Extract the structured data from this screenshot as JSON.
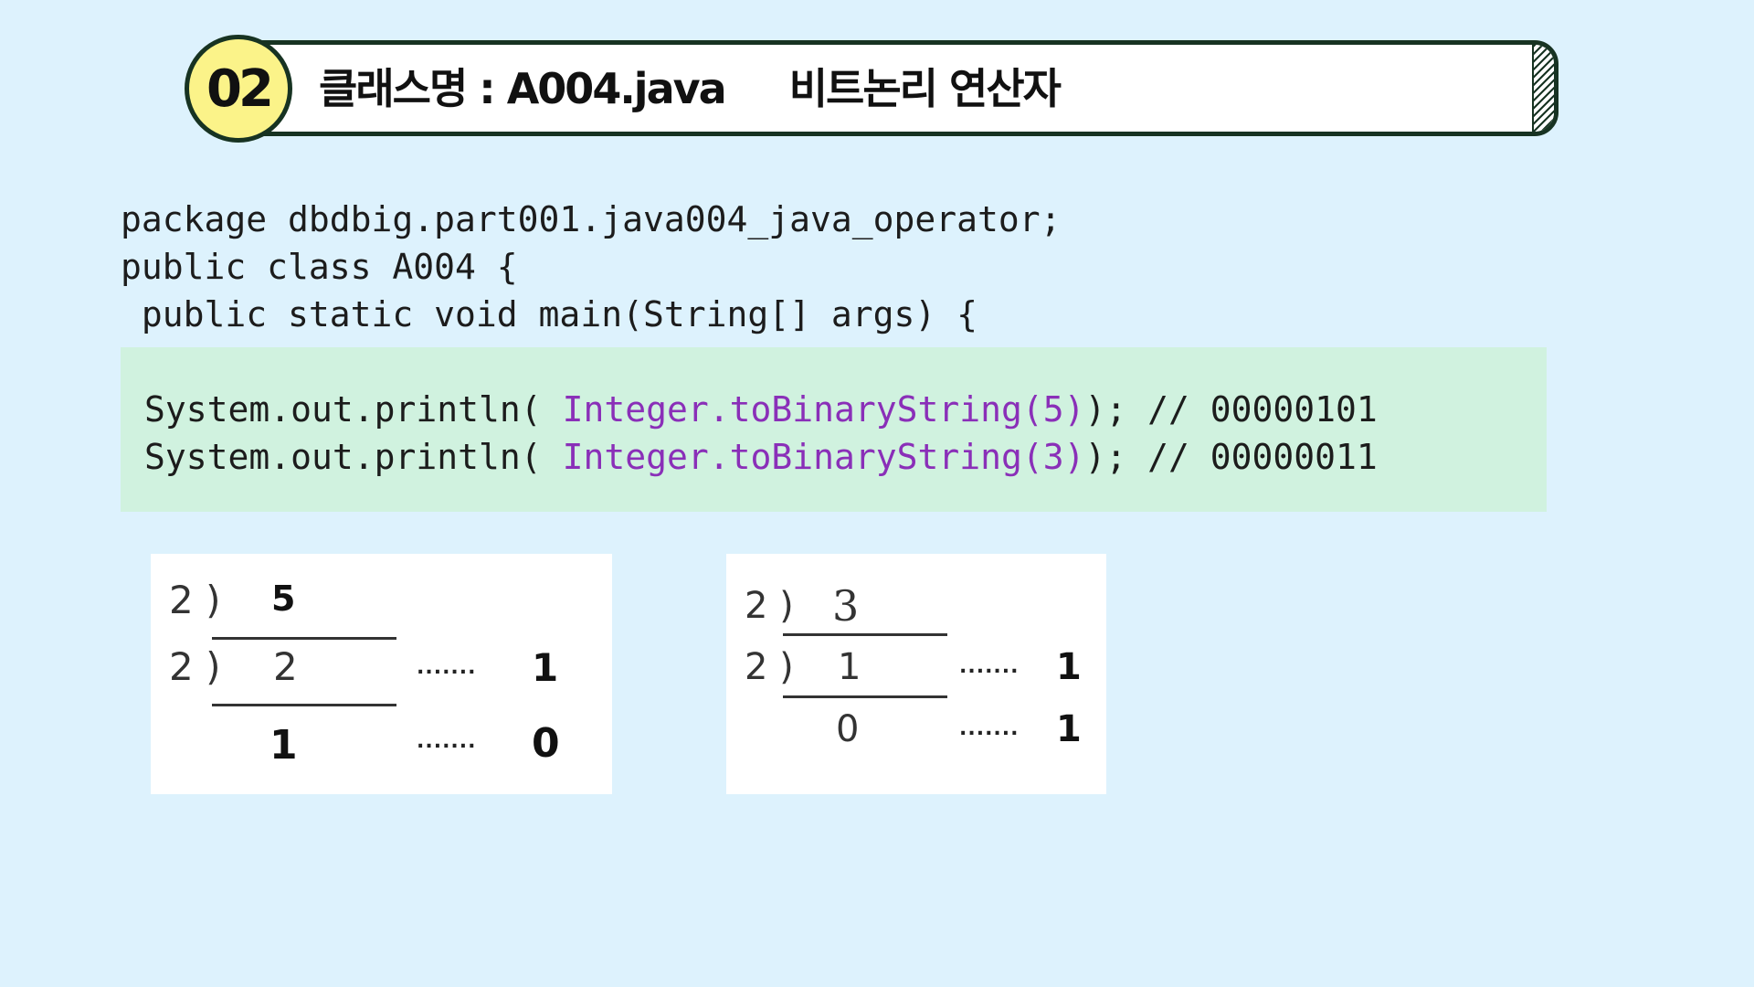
{
  "header": {
    "badge": "02",
    "title": "클래스명 : A004.java     비트논리 연산자"
  },
  "code": {
    "line1": "package dbdbig.part001.java004_java_operator;",
    "line2": "public class A004 {",
    "line3": " public static void main(String[] args) {",
    "block": [
      {
        "prefix": "System.out.println( ",
        "call": "Integer.toBinaryString(5)",
        "suffix": "); // 00000101"
      },
      {
        "prefix": "System.out.println( ",
        "call": "Integer.toBinaryString(3)",
        "suffix": "); // 00000011"
      }
    ]
  },
  "figure5": {
    "row1_divisor": "2 )",
    "row1_dividend": "5",
    "row2_divisor": "2 )",
    "row2_quotient": "2",
    "row2_dots": ".......",
    "row2_remainder": "1",
    "row3_quotient": "1",
    "row3_dots": ".......",
    "row3_remainder": "0"
  },
  "figure3": {
    "row1_divisor": "2 )",
    "row1_dividend": "3",
    "row2_divisor": "2 )",
    "row2_quotient": "1",
    "row2_dots": ".......",
    "row2_remainder": "1",
    "row3_quotient": "0",
    "row3_dots": ".......",
    "row3_remainder": "1"
  },
  "colors": {
    "background": "#ddf2fd",
    "code_block": "#d0f2df",
    "accent_purple": "#8a2fb8",
    "badge": "#fbf389",
    "outline": "#173322"
  }
}
